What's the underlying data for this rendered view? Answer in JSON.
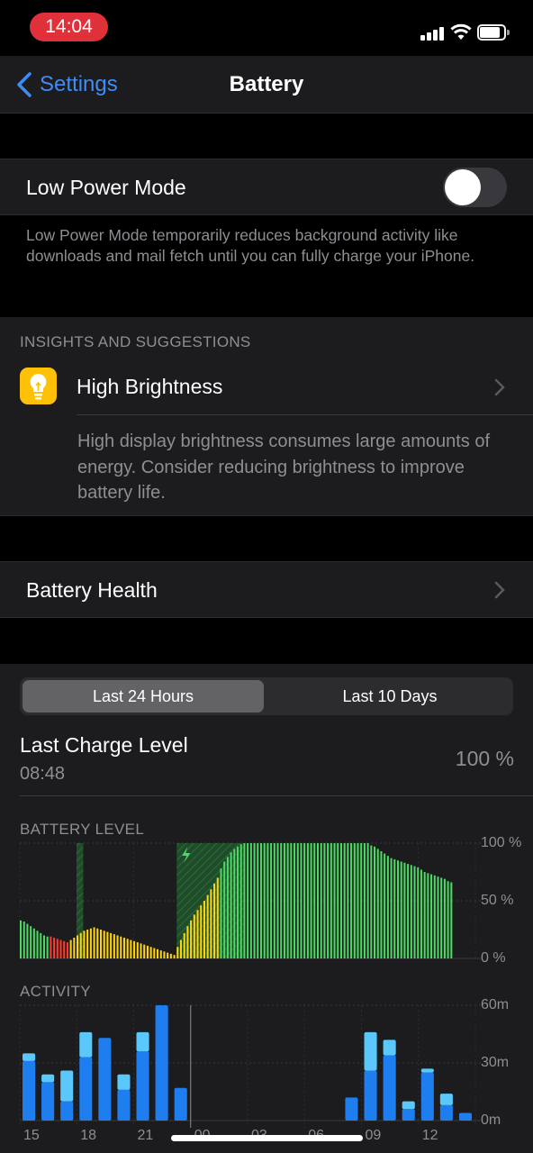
{
  "status_bar": {
    "time": "14:04"
  },
  "nav": {
    "back_label": "Settings",
    "title": "Battery"
  },
  "low_power": {
    "label": "Low Power Mode",
    "enabled": false,
    "footnote": "Low Power Mode temporarily reduces background activity like downloads and mail fetch until you can fully charge your iPhone."
  },
  "insights": {
    "header": "INSIGHTS AND SUGGESTIONS",
    "title": "High Brightness",
    "description": "High display brightness consumes large amounts of energy. Consider reducing brightness to improve battery life."
  },
  "battery_health": {
    "label": "Battery Health"
  },
  "range_tabs": {
    "active": "Last 24 Hours",
    "inactive": "Last 10 Days"
  },
  "last_charge": {
    "label": "Last Charge Level",
    "time": "08:48",
    "value": "100 %"
  },
  "colors": {
    "accent": "#3e8cf7",
    "green": "#4cd964",
    "yellow": "#ffd60a",
    "red": "#ff3b30",
    "activity_dark": "#1e7ef0",
    "activity_light": "#5ac8fa"
  },
  "chart_data": [
    {
      "type": "bar",
      "title": "BATTERY LEVEL",
      "y_tick_labels": [
        "100 %",
        "50 %",
        "0 %"
      ],
      "ylim": [
        0,
        100
      ],
      "values": [
        33,
        32,
        30,
        28,
        26,
        24,
        22,
        20,
        19,
        19,
        18,
        17,
        16,
        15,
        14,
        16,
        18,
        20,
        22,
        24,
        25,
        26,
        27,
        26,
        25,
        24,
        23,
        22,
        21,
        20,
        19,
        18,
        17,
        16,
        15,
        14,
        13,
        12,
        11,
        10,
        9,
        8,
        7,
        6,
        5,
        4,
        3,
        10,
        16,
        22,
        28,
        33,
        38,
        42,
        46,
        50,
        55,
        60,
        65,
        70,
        78,
        84,
        88,
        92,
        95,
        97,
        99,
        100,
        100,
        100,
        100,
        100,
        100,
        100,
        100,
        100,
        100,
        100,
        100,
        100,
        100,
        100,
        100,
        100,
        100,
        100,
        100,
        100,
        100,
        100,
        100,
        100,
        100,
        100,
        100,
        100,
        100,
        100,
        100,
        100,
        100,
        100,
        100,
        100,
        100,
        98,
        97,
        95,
        93,
        91,
        89,
        87,
        86,
        85,
        84,
        83,
        82,
        81,
        80,
        79,
        77,
        75,
        74,
        73,
        72,
        71,
        70,
        69,
        67,
        66
      ],
      "colors": [
        "green",
        "green",
        "green",
        "green",
        "green",
        "green",
        "green",
        "green",
        "green",
        "red",
        "red",
        "red",
        "red",
        "red",
        "red",
        "yellow",
        "yellow",
        "yellow",
        "yellow",
        "yellow",
        "yellow",
        "yellow",
        "yellow",
        "yellow",
        "yellow",
        "yellow",
        "yellow",
        "yellow",
        "yellow",
        "yellow",
        "yellow",
        "yellow",
        "yellow",
        "yellow",
        "yellow",
        "yellow",
        "yellow",
        "yellow",
        "yellow",
        "yellow",
        "yellow",
        "yellow",
        "yellow",
        "yellow",
        "yellow",
        "yellow",
        "yellow",
        "yellow",
        "yellow",
        "yellow",
        "yellow",
        "yellow",
        "yellow",
        "yellow",
        "yellow",
        "yellow",
        "yellow",
        "yellow",
        "yellow",
        "yellow",
        "green",
        "green",
        "green",
        "green",
        "green",
        "green",
        "green",
        "green",
        "green",
        "green",
        "green",
        "green",
        "green",
        "green",
        "green",
        "green",
        "green",
        "green",
        "green",
        "green",
        "green",
        "green",
        "green",
        "green",
        "green",
        "green",
        "green",
        "green",
        "green",
        "green",
        "green",
        "green",
        "green",
        "green",
        "green",
        "green",
        "green",
        "green",
        "green",
        "green",
        "green",
        "green",
        "green",
        "green",
        "green",
        "green",
        "green",
        "green",
        "green",
        "green",
        "green",
        "green",
        "green",
        "green",
        "green",
        "green",
        "green",
        "green",
        "green",
        "green",
        "green",
        "green",
        "green",
        "green",
        "green",
        "green",
        "green",
        "green",
        "green",
        "green"
      ]
    },
    {
      "type": "bar",
      "title": "ACTIVITY",
      "x_tick_labels": [
        "15",
        "18",
        "21",
        "00",
        "03",
        "06",
        "09",
        "12"
      ],
      "y_tick_labels": [
        "60m",
        "30m",
        "0m"
      ],
      "ylim": [
        0,
        60
      ],
      "series": [
        {
          "name": "screen_on",
          "values": [
            31,
            20,
            10,
            33,
            43,
            16,
            36,
            60,
            17,
            0,
            0,
            0,
            0,
            0,
            0,
            0,
            0,
            12,
            26,
            34,
            6,
            25,
            8,
            4
          ]
        },
        {
          "name": "screen_off",
          "values": [
            4,
            4,
            16,
            13,
            0,
            8,
            10,
            0,
            0,
            0,
            0,
            0,
            0,
            0,
            0,
            0,
            0,
            0,
            20,
            8,
            4,
            2,
            6,
            0
          ]
        }
      ]
    }
  ]
}
